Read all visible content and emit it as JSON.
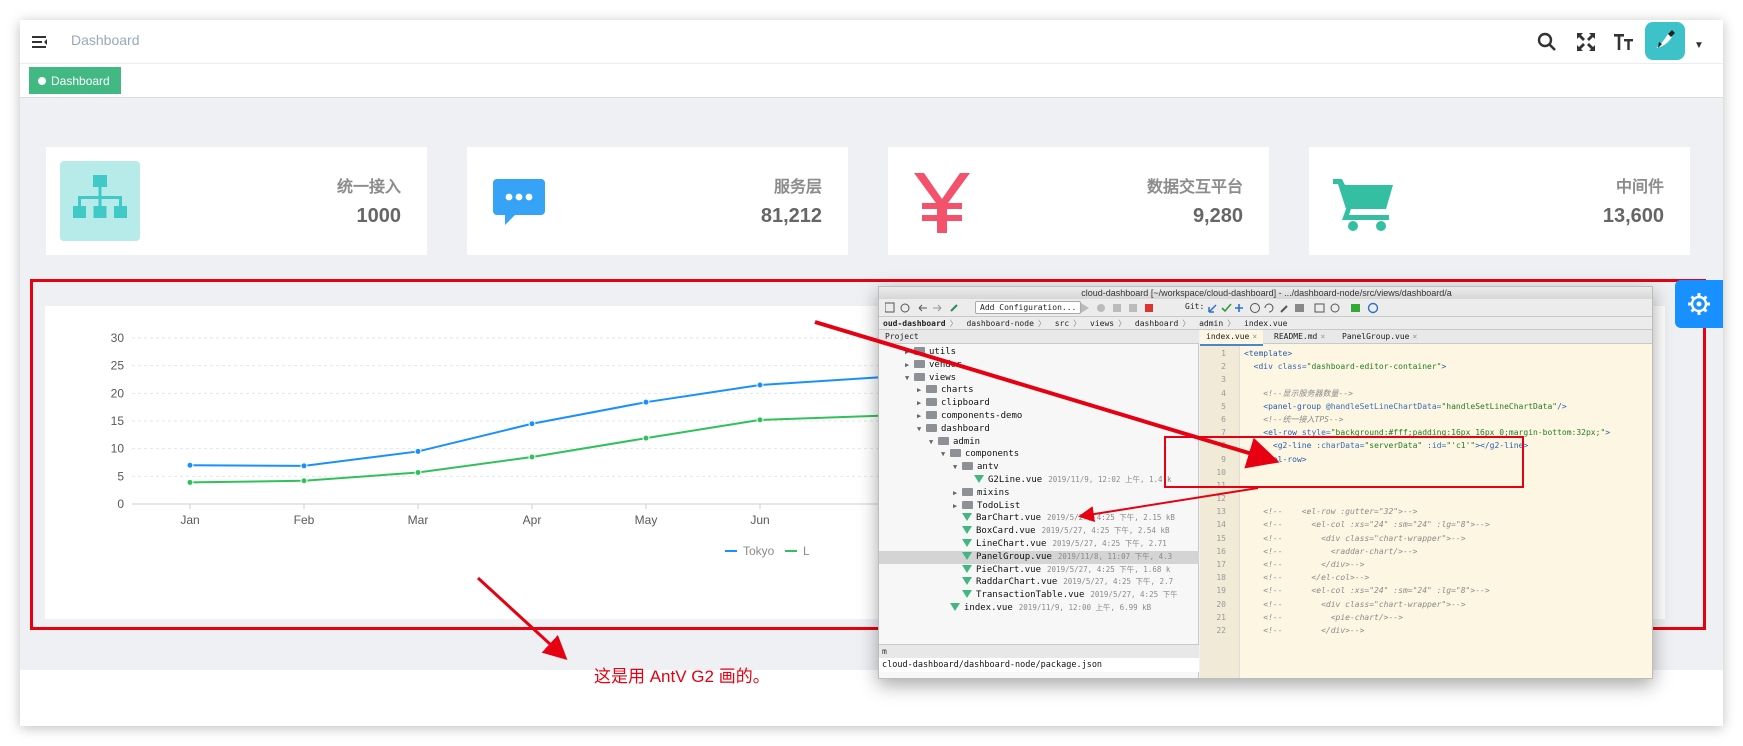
{
  "navbar": {
    "title": "Dashboard",
    "icons": [
      "hamburger-icon",
      "search-icon",
      "fullscreen-icon",
      "text-size-icon",
      "avatar",
      "caret-down-icon"
    ]
  },
  "tags": [
    {
      "label": "Dashboard",
      "active": true
    }
  ],
  "cards": [
    {
      "label": "统一接入",
      "value": "1000",
      "icon": "org-chart-icon",
      "color": "#40c9c6"
    },
    {
      "label": "服务层",
      "value": "81,212",
      "icon": "message-icon",
      "color": "#36a3f7"
    },
    {
      "label": "数据交互平台",
      "value": "9,280",
      "icon": "yen-icon",
      "color": "#f4516c"
    },
    {
      "label": "中间件",
      "value": "13,600",
      "icon": "shopping-cart-icon",
      "color": "#34bfa3"
    }
  ],
  "chart_data": {
    "type": "line",
    "categories": [
      "Jan",
      "Feb",
      "Mar",
      "Apr",
      "May",
      "Jun"
    ],
    "ylim": [
      0,
      30
    ],
    "yticks": [
      "0",
      "5",
      "10",
      "15",
      "20",
      "25",
      "30"
    ],
    "grid": true,
    "legend_position": "bottom",
    "series": [
      {
        "name": "Tokyo",
        "color": "#1890ff",
        "values": [
          7.0,
          6.9,
          9.5,
          14.5,
          18.4,
          21.5
        ]
      },
      {
        "name": "L",
        "color": "#2fc25b",
        "values": [
          3.9,
          4.2,
          5.7,
          8.5,
          11.9,
          15.2
        ]
      }
    ]
  },
  "ide": {
    "title": "cloud-dashboard [~/workspace/cloud-dashboard] - .../dashboard-node/src/views/dashboard/a",
    "add_configuration": "Add Configuration...",
    "git_label": "Git:",
    "breadcrumb": [
      "oud-dashboard",
      "dashboard-node",
      "src",
      "views",
      "dashboard",
      "admin",
      "index.vue"
    ],
    "project_label": "Project",
    "tabs": [
      {
        "label": "index.vue",
        "active": true
      },
      {
        "label": "README.md",
        "active": false
      },
      {
        "label": "PanelGroup.vue",
        "active": false
      }
    ],
    "tree": [
      {
        "indent": 2,
        "arrow": "▶",
        "kind": "folder",
        "name": "utils",
        "meta": ""
      },
      {
        "indent": 2,
        "arrow": "▶",
        "kind": "folder",
        "name": "vendor",
        "meta": ""
      },
      {
        "indent": 2,
        "arrow": "▼",
        "kind": "folder",
        "name": "views",
        "meta": ""
      },
      {
        "indent": 3,
        "arrow": "▶",
        "kind": "folder",
        "name": "charts",
        "meta": ""
      },
      {
        "indent": 3,
        "arrow": "▶",
        "kind": "folder",
        "name": "clipboard",
        "meta": ""
      },
      {
        "indent": 3,
        "arrow": "▶",
        "kind": "folder",
        "name": "components-demo",
        "meta": ""
      },
      {
        "indent": 3,
        "arrow": "▼",
        "kind": "folder",
        "name": "dashboard",
        "meta": ""
      },
      {
        "indent": 4,
        "arrow": "▼",
        "kind": "folder",
        "name": "admin",
        "meta": ""
      },
      {
        "indent": 5,
        "arrow": "▼",
        "kind": "folder",
        "name": "components",
        "meta": ""
      },
      {
        "indent": 6,
        "arrow": "▼",
        "kind": "folder",
        "name": "antv",
        "meta": ""
      },
      {
        "indent": 7,
        "arrow": "",
        "kind": "vue",
        "name": "G2Line.vue",
        "meta": "2019/11/9, 12:02 上午, 1.4 k"
      },
      {
        "indent": 6,
        "arrow": "▶",
        "kind": "folder",
        "name": "mixins",
        "meta": ""
      },
      {
        "indent": 6,
        "arrow": "▶",
        "kind": "folder",
        "name": "TodoList",
        "meta": ""
      },
      {
        "indent": 6,
        "arrow": "",
        "kind": "vue",
        "name": "BarChart.vue",
        "meta": "2019/5/27, 4:25 下午, 2.15 kB"
      },
      {
        "indent": 6,
        "arrow": "",
        "kind": "vue",
        "name": "BoxCard.vue",
        "meta": "2019/5/27, 4:25 下午, 2.54 kB"
      },
      {
        "indent": 6,
        "arrow": "",
        "kind": "vue",
        "name": "LineChart.vue",
        "meta": "2019/5/27, 4:25 下午, 2.71"
      },
      {
        "indent": 6,
        "arrow": "",
        "kind": "vue",
        "name": "PanelGroup.vue",
        "meta": "2019/11/8, 11:07 下午, 4.3",
        "selected": true
      },
      {
        "indent": 6,
        "arrow": "",
        "kind": "vue",
        "name": "PieChart.vue",
        "meta": "2019/5/27, 4:25 下午, 1.68 k"
      },
      {
        "indent": 6,
        "arrow": "",
        "kind": "vue",
        "name": "RaddarChart.vue",
        "meta": "2019/5/27, 4:25 下午, 2.7"
      },
      {
        "indent": 6,
        "arrow": "",
        "kind": "vue",
        "name": "TransactionTable.vue",
        "meta": "2019/5/27, 4:25 下午"
      },
      {
        "indent": 5,
        "arrow": "",
        "kind": "vue",
        "name": "index.vue",
        "meta": "2019/11/9, 12:00 上午, 6.99 kB"
      }
    ],
    "bottom_label": "m",
    "bottom_path": "cloud-dashboard/dashboard-node/package.json",
    "code": [
      {
        "n": "1",
        "html": "<span class='c-tag'>&lt;template&gt;</span>"
      },
      {
        "n": "2",
        "html": "  <span class='c-tag'>&lt;div</span> <span class='c-attr'>class=</span><span class='c-str'>\"dashboard-editor-container\"</span><span class='c-tag'>&gt;</span>"
      },
      {
        "n": "3",
        "html": ""
      },
      {
        "n": "4",
        "html": "    <span class='c-cmt'>&lt;!--显示服务器数量--&gt;</span>"
      },
      {
        "n": "5",
        "html": "    <span class='c-tag'>&lt;panel-group</span> <span class='c-attr'>@handleSetLineChartData=</span><span class='c-str'>\"handleSetLineChartData\"</span><span class='c-tag'>/&gt;</span>"
      },
      {
        "n": "6",
        "html": "    <span class='c-cmt'>&lt;!--统一接入TPS--&gt;</span>"
      },
      {
        "n": "7",
        "html": "    <span class='c-tag'>&lt;el-row</span> <span class='c-attr'>style=</span><span class='c-str'>\"background:#fff;padding:16px 16px 0;margin-bottom:32px;\"</span><span class='c-tag'>&gt;</span>"
      },
      {
        "n": "8",
        "html": "      <span class='c-tag'>&lt;g2-line</span> <span class='c-attr'>:charData=</span><span class='c-str'>\"serverData\"</span> <span class='c-attr'>:id=</span><span class='c-str'>\"'c1'\"</span><span class='c-tag'>&gt;&lt;/g2-line&gt;</span>"
      },
      {
        "n": "9",
        "html": "    <span class='c-tag'>&lt;/el-row&gt;</span>"
      },
      {
        "n": "10",
        "html": ""
      },
      {
        "n": "11",
        "html": ""
      },
      {
        "n": "12",
        "html": ""
      },
      {
        "n": "13",
        "html": "    <span class='c-cmt'>&lt;!--    &lt;el-row :gutter=\"32\"&gt;--&gt;</span>"
      },
      {
        "n": "14",
        "html": "    <span class='c-cmt'>&lt;!--      &lt;el-col :xs=\"24\" :sm=\"24\" :lg=\"8\"&gt;--&gt;</span>"
      },
      {
        "n": "15",
        "html": "    <span class='c-cmt'>&lt;!--        &lt;div class=\"chart-wrapper\"&gt;--&gt;</span>"
      },
      {
        "n": "16",
        "html": "    <span class='c-cmt'>&lt;!--          &lt;raddar-chart/&gt;--&gt;</span>"
      },
      {
        "n": "17",
        "html": "    <span class='c-cmt'>&lt;!--        &lt;/div&gt;--&gt;</span>"
      },
      {
        "n": "18",
        "html": "    <span class='c-cmt'>&lt;!--      &lt;/el-col&gt;--&gt;</span>"
      },
      {
        "n": "19",
        "html": "    <span class='c-cmt'>&lt;!--      &lt;el-col :xs=\"24\" :sm=\"24\" :lg=\"8\"&gt;--&gt;</span>"
      },
      {
        "n": "20",
        "html": "    <span class='c-cmt'>&lt;!--        &lt;div class=\"chart-wrapper\"&gt;--&gt;</span>"
      },
      {
        "n": "21",
        "html": "    <span class='c-cmt'>&lt;!--          &lt;pie-chart/&gt;--&gt;</span>"
      },
      {
        "n": "22",
        "html": "    <span class='c-cmt'>&lt;!--        &lt;/div&gt;--&gt;</span>"
      }
    ]
  },
  "annotation": "这是用 AntV G2 画的。",
  "accent_red": "#e60012"
}
